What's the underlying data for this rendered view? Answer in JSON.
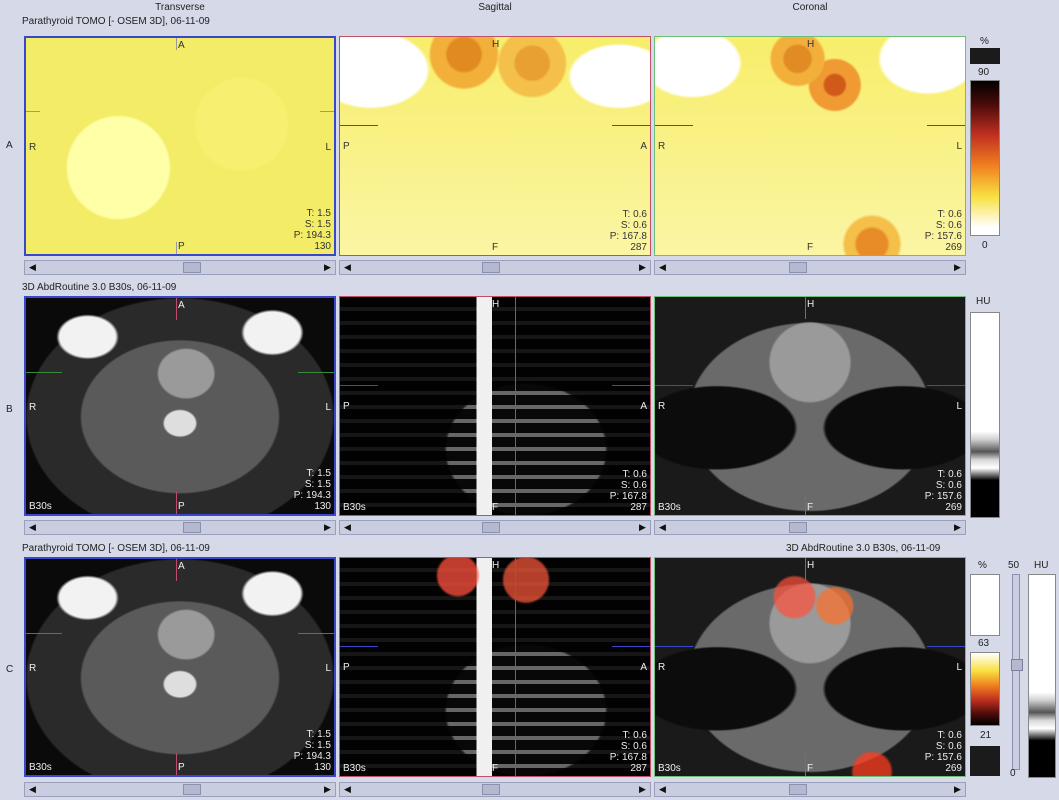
{
  "columns": [
    "Transverse",
    "Sagittal",
    "Coronal"
  ],
  "row_labels": [
    "A",
    "B",
    "C"
  ],
  "rows": {
    "a": {
      "title": "Parathyroid TOMO [- OSEM 3D], 06-11-09",
      "views": [
        {
          "orient": [
            "A",
            "R",
            "L",
            "P"
          ],
          "info": [
            "T: 1.5",
            "S: 1.5",
            "P: 194.3",
            "130"
          ],
          "series": ""
        },
        {
          "orient": [
            "H",
            "P",
            "A",
            "F"
          ],
          "info": [
            "T: 0.6",
            "S: 0.6",
            "P: 167.8",
            "287"
          ],
          "series": ""
        },
        {
          "orient": [
            "H",
            "R",
            "L",
            "F"
          ],
          "info": [
            "T: 0.6",
            "S: 0.6",
            "P: 157.6",
            "269"
          ],
          "series": ""
        }
      ],
      "colorbar": {
        "unit": "%",
        "max": "90",
        "min": "0"
      }
    },
    "b": {
      "title": "3D AbdRoutine 3.0 B30s, 06-11-09",
      "views": [
        {
          "orient": [
            "A",
            "R",
            "L",
            "P"
          ],
          "info": [
            "T: 1.5",
            "S: 1.5",
            "P: 194.3",
            "130"
          ],
          "series": "B30s"
        },
        {
          "orient": [
            "H",
            "P",
            "A",
            "F"
          ],
          "info": [
            "T: 0.6",
            "S: 0.6",
            "P: 167.8",
            "287"
          ],
          "series": "B30s"
        },
        {
          "orient": [
            "H",
            "R",
            "L",
            "F"
          ],
          "info": [
            "T: 0.6",
            "S: 0.6",
            "P: 157.6",
            "269"
          ],
          "series": "B30s"
        }
      ],
      "colorbar": {
        "unit": "HU"
      }
    },
    "c": {
      "title": "Parathyroid TOMO [- OSEM 3D], 06-11-09",
      "title_right": "3D AbdRoutine 3.0 B30s, 06-11-09",
      "views": [
        {
          "orient": [
            "A",
            "R",
            "L",
            "P"
          ],
          "info": [
            "T: 1.5",
            "S: 1.5",
            "P: 194.3",
            "130"
          ],
          "series": "B30s"
        },
        {
          "orient": [
            "H",
            "P",
            "A",
            "F"
          ],
          "info": [
            "T: 0.6",
            "S: 0.6",
            "P: 167.8",
            "287"
          ],
          "series": "B30s"
        },
        {
          "orient": [
            "H",
            "R",
            "L",
            "F"
          ],
          "info": [
            "T: 0.6",
            "S: 0.6",
            "P: 157.6",
            "269"
          ],
          "series": "B30s"
        }
      ],
      "colorbar": {
        "unit": "%",
        "max": "63",
        "min": "21",
        "hu_unit": "HU",
        "blend_top": "50",
        "blend_bottom": "0"
      }
    }
  },
  "colors": {
    "background": "#d5d9e8",
    "transverse_border": "#3b47c9",
    "sagittal_border": "#c0506a",
    "coronal_border": "#6fbf7a"
  },
  "icons": {
    "scroll_left": "triangle-left-icon",
    "scroll_right": "triangle-right-icon"
  }
}
